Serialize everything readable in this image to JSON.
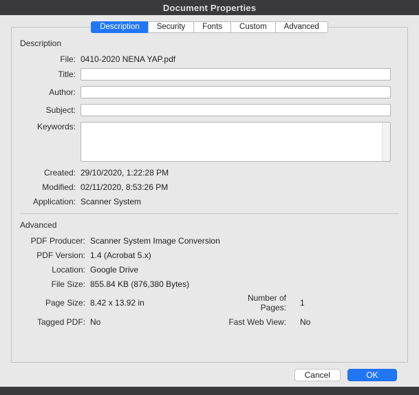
{
  "window": {
    "title": "Document Properties"
  },
  "tabs": [
    {
      "label": "Description"
    },
    {
      "label": "Security"
    },
    {
      "label": "Fonts"
    },
    {
      "label": "Custom"
    },
    {
      "label": "Advanced"
    }
  ],
  "description": {
    "heading": "Description",
    "file": {
      "label": "File:",
      "value": "0410-2020 NENA YAP.pdf"
    },
    "title": {
      "label": "Title:",
      "value": ""
    },
    "author": {
      "label": "Author:",
      "value": ""
    },
    "subject": {
      "label": "Subject:",
      "value": ""
    },
    "keywords": {
      "label": "Keywords:",
      "value": ""
    },
    "created": {
      "label": "Created:",
      "value": "29/10/2020, 1:22:28 PM"
    },
    "modified": {
      "label": "Modified:",
      "value": "02/11/2020, 8:53:26 PM"
    },
    "application": {
      "label": "Application:",
      "value": "Scanner System"
    }
  },
  "advanced": {
    "heading": "Advanced",
    "pdf_producer": {
      "label": "PDF Producer:",
      "value": "Scanner System Image Conversion"
    },
    "pdf_version": {
      "label": "PDF Version:",
      "value": "1.4 (Acrobat 5.x)"
    },
    "location": {
      "label": "Location:",
      "value": "Google Drive"
    },
    "file_size": {
      "label": "File Size:",
      "value": "855.84 KB (876,380 Bytes)"
    },
    "page_size": {
      "label": "Page Size:",
      "value": "8.42 x 13.92 in"
    },
    "number_of_pages": {
      "label": "Number of Pages:",
      "value": "1"
    },
    "tagged_pdf": {
      "label": "Tagged PDF:",
      "value": "No"
    },
    "fast_web_view": {
      "label": "Fast Web View:",
      "value": "No"
    }
  },
  "buttons": {
    "cancel": "Cancel",
    "ok": "OK"
  },
  "colors": {
    "accent": "#2176f5",
    "titlebar": "#3a3a3c",
    "body": "#e8e8e8"
  }
}
